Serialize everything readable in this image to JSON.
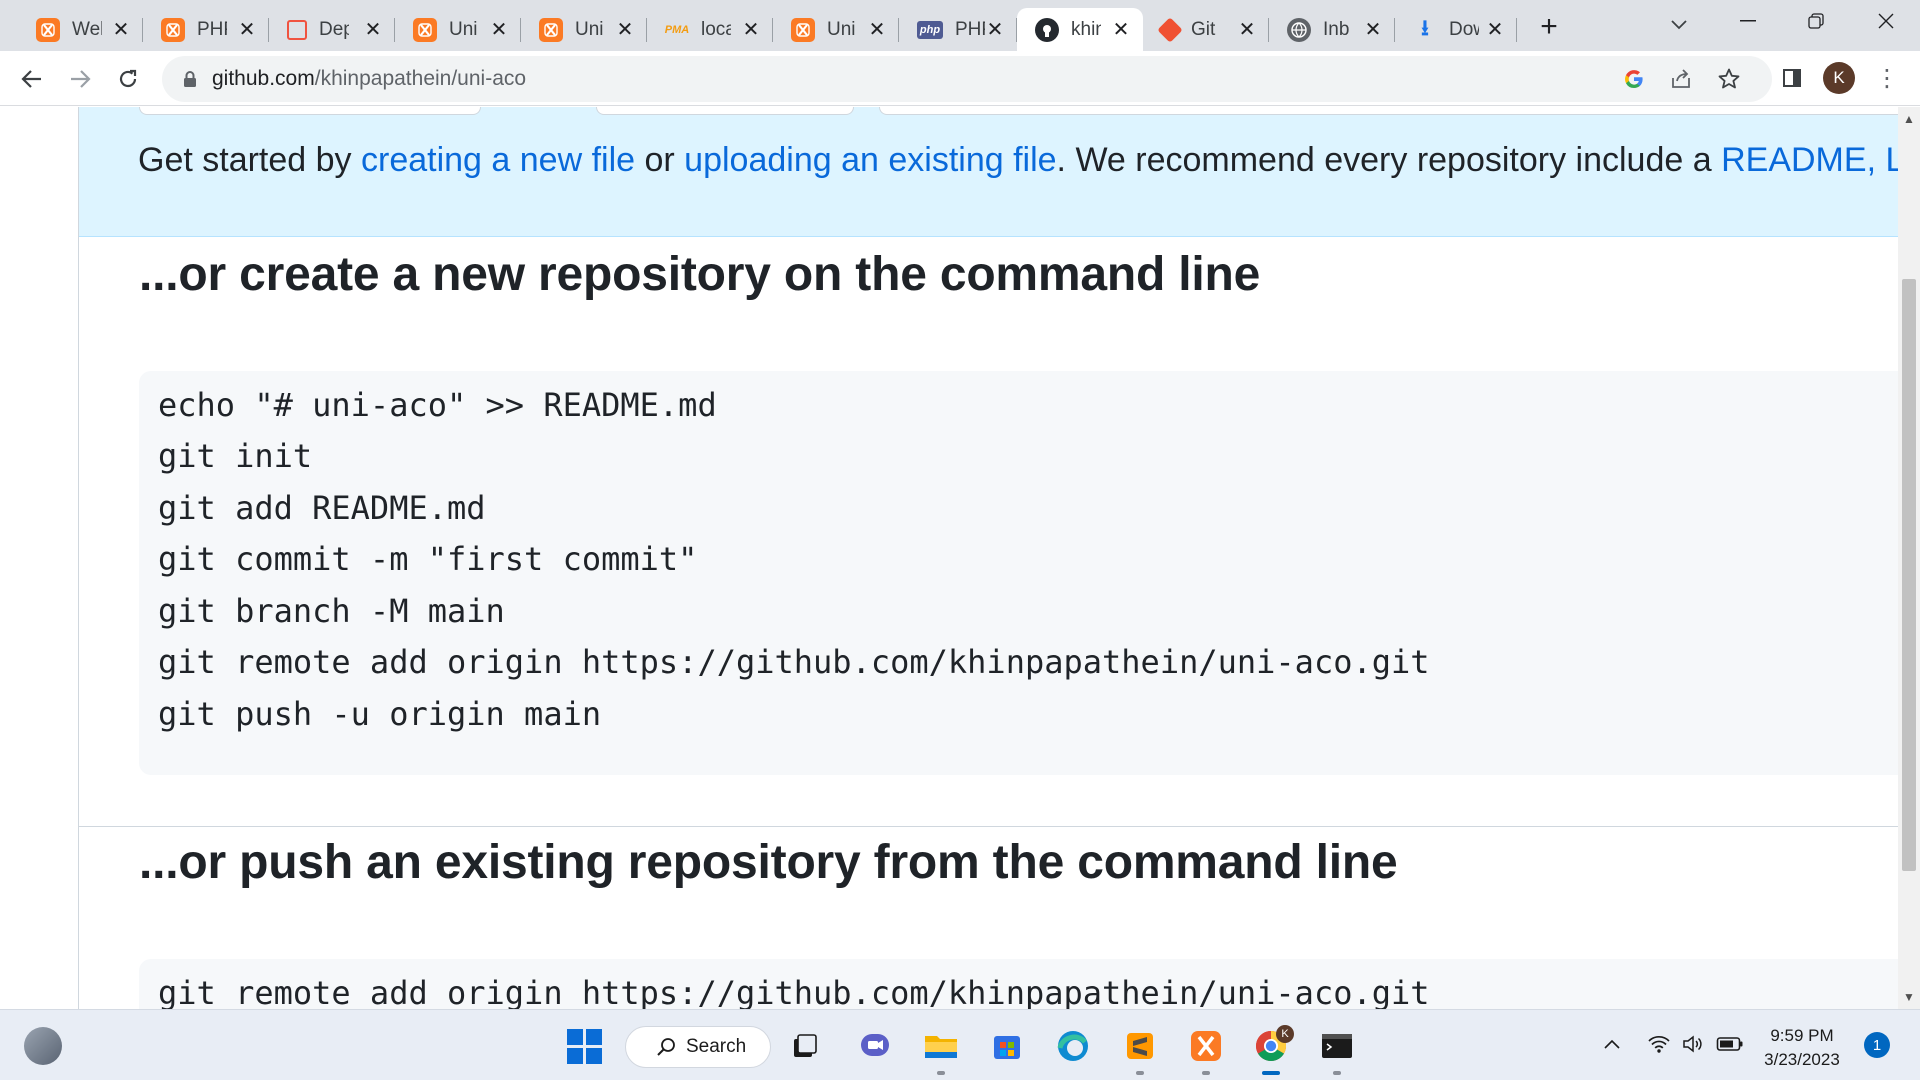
{
  "browser": {
    "tabs": [
      {
        "title": "Welcome to XAMPP",
        "favicon": "xampp-icon",
        "shown": "Wel"
      },
      {
        "title": "PHP",
        "favicon": "xampp-icon",
        "shown": "PHP"
      },
      {
        "title": "Deployment",
        "favicon": "laravel-icon",
        "shown": "Dep"
      },
      {
        "title": "Uni",
        "favicon": "xampp-icon",
        "shown": "Uni"
      },
      {
        "title": "Uni",
        "favicon": "xampp-icon",
        "shown": "Uni"
      },
      {
        "title": "localhost",
        "favicon": "phpmyadmin-icon",
        "shown": "loca"
      },
      {
        "title": "Uni",
        "favicon": "xampp-icon",
        "shown": "Uni"
      },
      {
        "title": "PHP",
        "favicon": "php-icon",
        "shown": "PHP"
      },
      {
        "title": "khinpapathein/uni-aco",
        "favicon": "github-icon",
        "shown": "khin",
        "active": true
      },
      {
        "title": "Git",
        "favicon": "git-icon",
        "shown": "Git"
      },
      {
        "title": "Inbox",
        "favicon": "globe-icon",
        "shown": "Inb"
      },
      {
        "title": "Downloads",
        "favicon": "download-icon",
        "shown": "Dow"
      }
    ],
    "url_host": "github.com",
    "url_path": "/khinpapathein/uni-aco",
    "profile_initial": "K",
    "php_badge": "php",
    "pma_badge": "PMA"
  },
  "page": {
    "banner": {
      "prefix": "Get started by ",
      "link1": "creating a new file",
      "middle": " or ",
      "link2": "uploading an existing file",
      "suffix": ". We recommend every repository include a ",
      "link3": "README",
      "tail": ", L"
    },
    "section1": {
      "title": "...or create a new repository on the command line",
      "lines": [
        "echo \"# uni-aco\" >> README.md",
        "git init",
        "git add README.md",
        "git commit -m \"first commit\"",
        "git branch -M main",
        "git remote add origin https://github.com/khinpapathein/uni-aco.git",
        "git push -u origin main"
      ]
    },
    "section2": {
      "title": "...or push an existing repository from the command line",
      "lines": [
        "git remote add origin https://github.com/khinpapathein/uni-aco.git"
      ]
    }
  },
  "taskbar": {
    "search_label": "Search",
    "time": "9:59 PM",
    "date": "3/23/2023",
    "notifications": "1",
    "chrome_badge": "K"
  },
  "colors": {
    "link": "#0969da",
    "banner_bg": "#ddf4ff",
    "code_bg": "#f6f8fa"
  }
}
